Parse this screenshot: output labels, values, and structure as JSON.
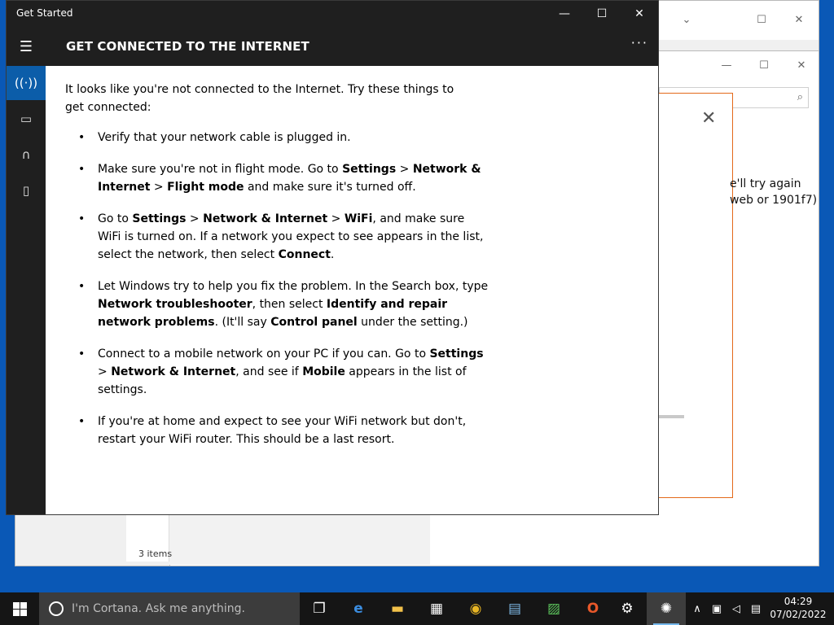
{
  "background": {
    "desktop_color": "#0a58b6",
    "explorer": {
      "search_icon": "magnifier-icon",
      "status_text": "3 items"
    },
    "dialog": {
      "accent_color": "#e3691a",
      "close_glyph": "✕",
      "partial_text": "e'll try again web or 1901f7)"
    }
  },
  "window": {
    "title": "Get Started",
    "controls": {
      "minimize": "—",
      "maximize": "☐",
      "close": "✕"
    },
    "header": {
      "title": "GET CONNECTED TO THE INTERNET",
      "more": "···"
    },
    "rail": [
      {
        "icon": "wifi-signal-icon",
        "glyph": "((·))",
        "active": true
      },
      {
        "icon": "laptop-icon",
        "glyph": "▭",
        "active": false
      },
      {
        "icon": "headset-icon",
        "glyph": "∩",
        "active": false
      },
      {
        "icon": "microphone-icon",
        "glyph": "▯",
        "active": false
      }
    ]
  },
  "content": {
    "intro": "It looks like you're not connected to the Internet. Try these things to get connected:",
    "tips": [
      {
        "text": "Verify that your network cable is plugged in."
      },
      {
        "a": "Make sure you're not in flight mode. Go to ",
        "b1": "Settings",
        "c": " > ",
        "b2": "Network & Internet",
        "d": " > ",
        "b3": "Flight mode",
        "e": " and make sure it's turned off."
      },
      {
        "a": "Go to ",
        "b1": "Settings",
        "c": " > ",
        "b2": "Network & Internet",
        "d": " > ",
        "b3": "WiFi",
        "e": ", and make sure WiFi is turned on. If a network you expect to see appears in the list, select the network, then select ",
        "b4": "Connect",
        "f": "."
      },
      {
        "a": "Let Windows try to help you fix the problem. In the Search box, type ",
        "b1": "Network troubleshooter",
        "c": ", then select ",
        "b2": "Identify and repair network problems",
        "d": ". (It'll say ",
        "b3": "Control panel",
        "e": " under the setting.)"
      },
      {
        "a": "Connect to a mobile network on your PC if you can. Go to ",
        "b1": "Settings",
        "c": " > ",
        "b2": "Network & Internet",
        "d": ", and see if ",
        "b3": "Mobile",
        "e": " appears in the list of settings."
      },
      {
        "text": "If you're at home and expect to see your WiFi network but don't, restart your WiFi router. This should be a last resort."
      }
    ]
  },
  "taskbar": {
    "cortana_placeholder": "I'm Cortana. Ask me anything.",
    "apps": [
      {
        "name": "task-view-icon",
        "glyph": "❐"
      },
      {
        "name": "edge-icon",
        "glyph": "e"
      },
      {
        "name": "file-explorer-icon",
        "glyph": "▬"
      },
      {
        "name": "store-icon",
        "glyph": "▦"
      },
      {
        "name": "chrome-icon",
        "glyph": "◉"
      },
      {
        "name": "control-panel-icon",
        "glyph": "▤"
      },
      {
        "name": "task-manager-icon",
        "glyph": "▨"
      },
      {
        "name": "office-icon",
        "glyph": "O"
      },
      {
        "name": "settings-icon",
        "glyph": "⚙"
      },
      {
        "name": "get-started-icon",
        "glyph": "✺"
      }
    ],
    "tray": {
      "chevron": "∧",
      "network": "▣",
      "volume": "◁",
      "notifications": "▤"
    },
    "time": "04:29",
    "date": "07/02/2022"
  }
}
